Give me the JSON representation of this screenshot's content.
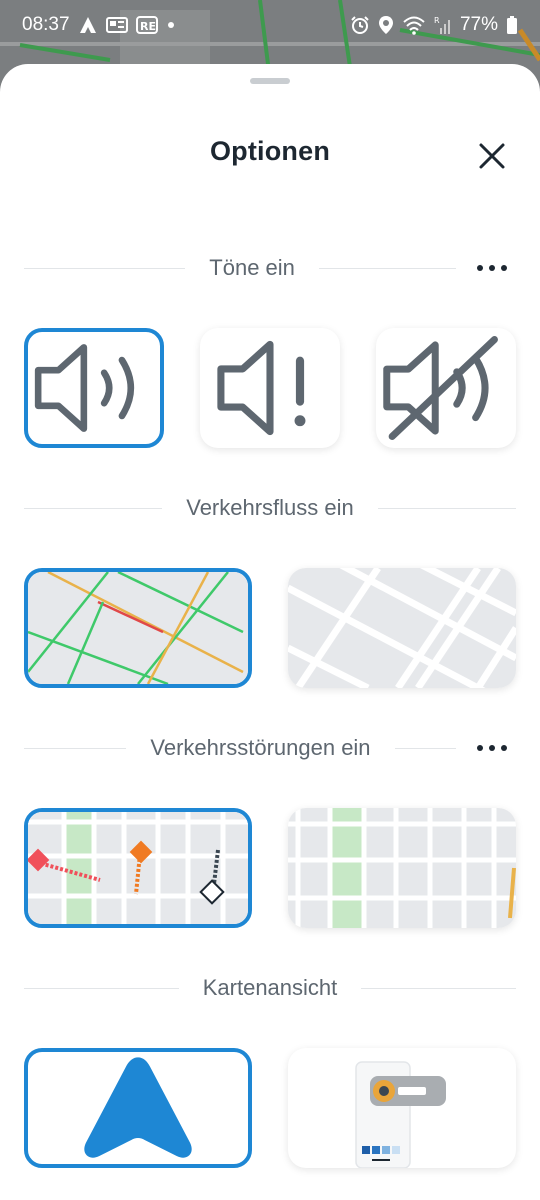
{
  "status_bar": {
    "time": "08:37",
    "battery": "77%",
    "left_icons": [
      "app-a-icon",
      "news-icon",
      "re-icon",
      "dot-icon"
    ],
    "right_icons": [
      "alarm-icon",
      "location-icon",
      "wifi-icon",
      "signal-icon",
      "battery-icon"
    ]
  },
  "sheet": {
    "title": "Optionen",
    "close_icon": "close-icon"
  },
  "sections": {
    "sounds": {
      "label": "Töne ein",
      "options": [
        "sound-on-icon",
        "sound-alerts-icon",
        "sound-off-icon"
      ],
      "selected_index": 0
    },
    "traffic_flow": {
      "label": "Verkehrsfluss ein",
      "options": [
        "traffic-flow-on-map",
        "traffic-flow-off-map"
      ],
      "selected_index": 0
    },
    "incidents": {
      "label": "Verkehrsstörungen ein",
      "options": [
        "incidents-on-map",
        "incidents-off-map"
      ],
      "selected_index": 0
    },
    "map_view": {
      "label": "Kartenansicht",
      "options": [
        "navigation-arrow-view",
        "compact-view"
      ],
      "selected_index": 0
    }
  },
  "colors": {
    "accent": "#1e87d4",
    "title": "#1d2731",
    "section_label": "#5e6770",
    "traffic_green": "#3fc96a",
    "traffic_yellow": "#e9b24a",
    "traffic_red": "#e04848",
    "incident_orange": "#f07a22",
    "incident_red": "#f0505a"
  }
}
